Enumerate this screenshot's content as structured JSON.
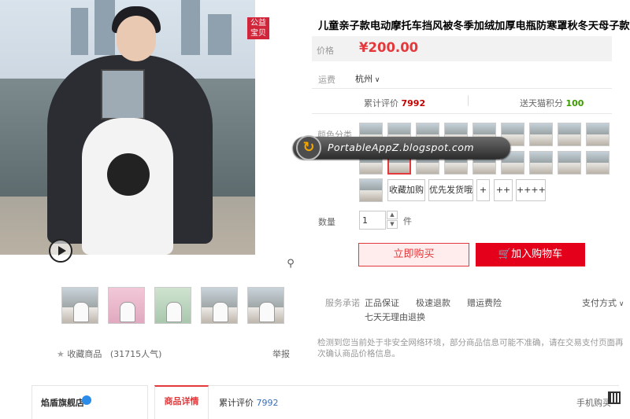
{
  "gallery": {
    "badge_line1": "公益",
    "badge_line2": "宝贝",
    "zoom_icon": "magnifier-icon",
    "play_icon": "play-icon",
    "thumb_count": 5,
    "favorite_label": "收藏商品",
    "favorite_count": "(31715人气)",
    "report_label": "举报"
  },
  "product": {
    "title": "儿童亲子款电动摩托车挡风被冬季加绒加厚电瓶防寒罩秋冬天母子款",
    "price_label": "价格",
    "price": "¥200.00",
    "shipping_label": "运费",
    "shipping_city": "杭州",
    "reviews_label": "累计评价",
    "reviews_count": "7992",
    "points_label": "送天猫积分",
    "points_value": "100",
    "color_label": "颜色分类",
    "swatch_rows": 2,
    "option_labels": [
      "收藏加购",
      "优先发货哦",
      "+",
      "++",
      "++++"
    ],
    "qty_label": "数量",
    "qty_value": "1",
    "qty_unit": "件",
    "buy_now": "立即购买",
    "add_to_cart": "加入购物车",
    "service_label": "服务承诺",
    "services": [
      "正品保证",
      "极速退款",
      "赠运费险",
      "七天无理由退换"
    ],
    "payment_label": "支付方式",
    "notice": "检测到您当前处于非安全网络环境，部分商品信息可能不准确，请在交易支付页面再次确认商品价格信息。"
  },
  "watermark": "PortableAppZ.blogspot.com",
  "store": {
    "name": "焰盾旗舰店"
  },
  "tabs": {
    "detail": "商品详情",
    "reviews_label": "累计评价",
    "reviews_count": "7992",
    "mobile_buy": "手机购买"
  },
  "colors": {
    "accent": "#e4393c",
    "cart_red": "#e4001b",
    "points_green": "#3c9a00",
    "link_blue": "#3a6fb7"
  }
}
